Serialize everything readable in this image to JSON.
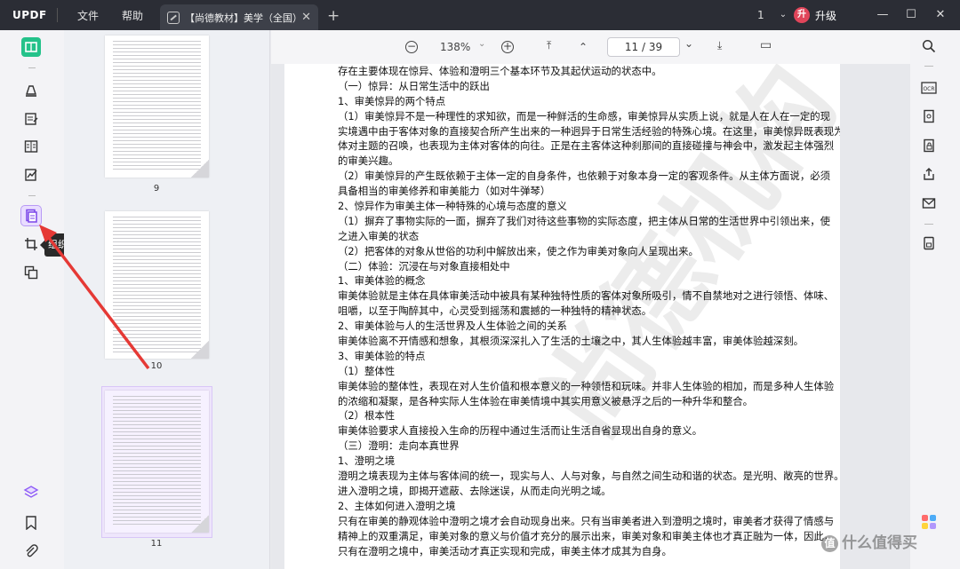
{
  "titlebar": {
    "logo_text": "UPDF",
    "menu": [
      "文件",
      "帮助"
    ],
    "tab_title": "【尚德教材】美学（全国）",
    "tab_close": "✕",
    "tab_add": "+",
    "window_count": "1",
    "window_chevron": "⌄",
    "upgrade_badge": "升",
    "upgrade_label": "升级",
    "minimize": "—",
    "maximize": "☐",
    "close": "✕"
  },
  "left_toolbar": {
    "tooltip": "组织页面"
  },
  "thumbnails": [
    {
      "number": "9"
    },
    {
      "number": "10"
    },
    {
      "number": "11"
    }
  ],
  "doc_toolbar": {
    "zoom_out": "−",
    "zoom_level": "138%",
    "zoom_dropdown": "⌄",
    "zoom_in": "+",
    "first_page": "⤒",
    "prev_page": "⌃",
    "page_indicator": "11  /  39",
    "next_page": "⌄",
    "last_page": "⤓",
    "present": "▭"
  },
  "document": {
    "lines": [
      "存在主要体现在惊异、体验和澄明三个基本环节及其起伏运动的状态中。",
      "（一）惊异：从日常生活中的跃出",
      "1、审美惊异的两个特点",
      "（1）审美惊异不是一种理性的求知欲，而是一种鲜活的生命感，审美惊异从实质上说，就是人在人在一定的现",
      "实境遇中由于客体对象的直接契合所产生出来的一种迥异于日常生活经验的特殊心境。在这里，审美惊异既表现为客",
      "体对主题的召唤，也表现为主体对客体的向往。正是在主客体这种刹那间的直接碰撞与神会中，激发起主体强烈",
      "的审美兴趣。",
      "（2）审美惊异的产生既依赖于主体一定的自身条件，也依赖于对象本身一定的客观条件。从主体方面说，必须",
      "具备相当的审美修养和审美能力（如对牛弹琴）",
      "2、惊异作为审美主体一种特殊的心境与态度的意义",
      "（1）摒弃了事物实际的一面，摒弃了我们对待这些事物的实际态度，把主体从日常的生活世界中引领出来，使",
      "之进入审美的状态",
      "（2）把客体的对象从世俗的功利中解放出来，使之作为审美对象向人呈现出来。",
      "（二）体验：沉浸在与对象直接相处中",
      "1、审美体验的概念",
      "审美体验就是主体在具体审美活动中被具有某种独特性质的客体对象所吸引，情不自禁地对之进行领悟、体味、",
      "咀嚼，以至于陶醉其中，心灵受到摇荡和震撼的一种独特的精神状态。",
      "2、审美体验与人的生活世界及人生体验之间的关系",
      "审美体验离不开情感和想象，其根须深深扎入了生活的土壤之中，其人生体验越丰富，审美体验越深刻。",
      "3、审美体验的特点",
      "（1）整体性",
      "审美体验的整体性，表现在对人生价值和根本意义的一种领悟和玩味。并非人生体验的相加，而是多种人生体验",
      "的浓缩和凝聚，是各种实际人生体验在审美情境中其实用意义被悬浮之后的一种升华和整合。",
      "（2）根本性",
      "审美体验要求人直接投入生命的历程中通过生活而让生活自省显现出自身的意义。",
      "（三）澄明：走向本真世界",
      "1、澄明之境",
      "澄明之境表现为主体与客体间的统一，现实与人、人与对象，与自然之间生动和谐的状态。是光明、敞亮的世界。",
      "进入澄明之境，即揭开遮蔽、去除迷误，从而走向光明之域。",
      "2、主体如何进入澄明之境",
      "只有在审美的静观体验中澄明之境才会自动现身出来。只有当审美者进入到澄明之境时，审美者才获得了情感与",
      "精神上的双重满足，审美对象的意义与价值才充分的展示出来，审美对象和审美主体也才真正融为一体，因此，",
      "只有在澄明之境中，审美活动才真正实现和完成，审美主体才成其为自身。"
    ],
    "watermark": "尚德机构"
  },
  "brand": {
    "badge": "值",
    "text": "什么值得买"
  },
  "colors": {
    "titlebar": "#2b2d35",
    "accent_green": "#24c28a",
    "accent_purple": "#8e5cf7",
    "annotation_red": "#e53935"
  }
}
